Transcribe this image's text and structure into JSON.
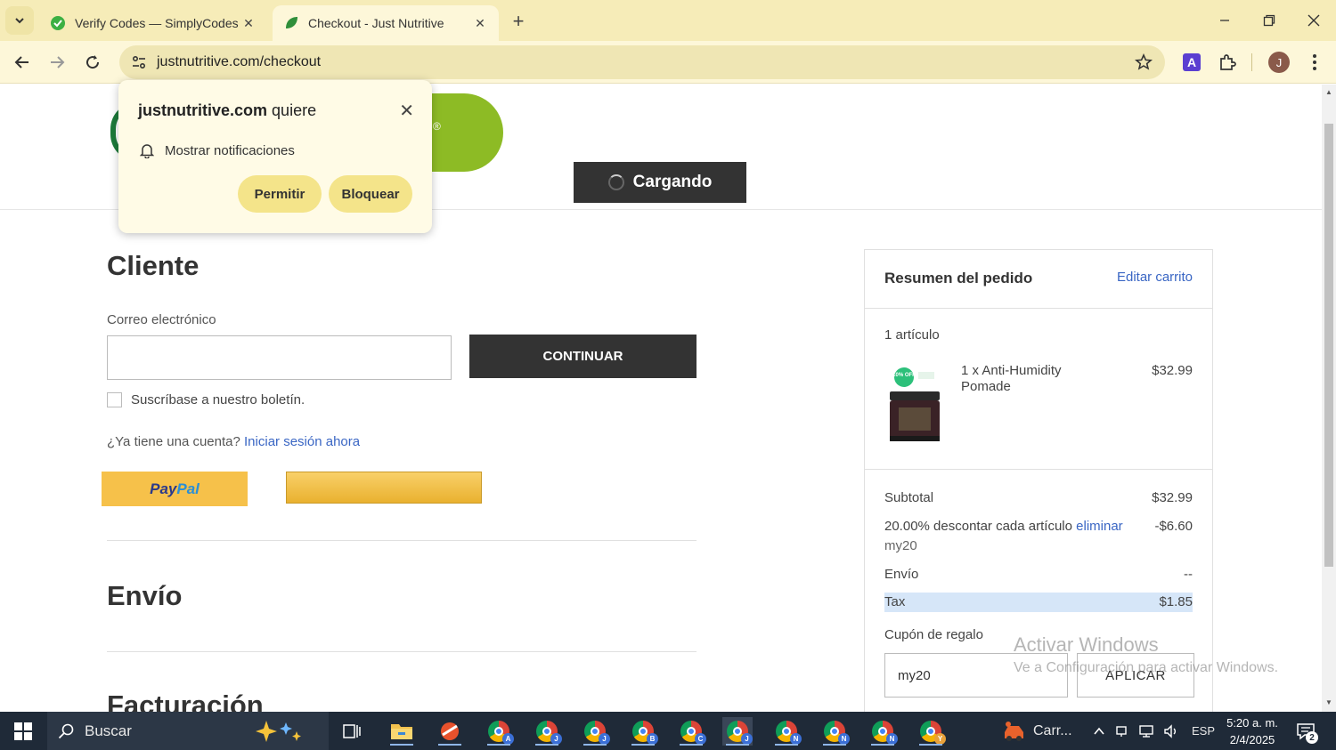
{
  "browser": {
    "tabs": [
      {
        "title": "Verify Codes — SimplyCodes",
        "active": false,
        "icon": "simplycodes-favicon"
      },
      {
        "title": "Checkout - Just Nutritive",
        "active": true,
        "icon": "leaf-favicon"
      }
    ],
    "url": "justnutritive.com/checkout",
    "profile_initial": "J",
    "extension_initial": "A"
  },
  "permission_popup": {
    "site": "justnutritive.com",
    "wants": "quiere",
    "request": "Mostrar notificaciones",
    "allow": "Permitir",
    "block": "Bloquear"
  },
  "header": {
    "loading_label": "Cargando",
    "logo_mark": "®"
  },
  "customer": {
    "heading": "Cliente",
    "email_label": "Correo electrónico",
    "email_value": "",
    "continue_label": "CONTINUAR",
    "newsletter_label": "Suscríbase a nuestro boletín.",
    "account_question": "¿Ya tiene una cuenta?",
    "login_link": "Iniciar sesión ahora",
    "paypal_pay": "Pay",
    "paypal_pal": "Pal"
  },
  "shipping": {
    "heading": "Envío"
  },
  "billing": {
    "heading": "Facturación"
  },
  "summary": {
    "title": "Resumen del pedido",
    "edit_cart": "Editar carrito",
    "item_count": "1 artículo",
    "product_name": "1 x Anti-Humidity Pomade",
    "product_price": "$32.99",
    "product_badge": "10% OFF",
    "subtotal_label": "Subtotal",
    "subtotal_value": "$32.99",
    "discount_label": "20.00% descontar cada artículo",
    "discount_remove": "eliminar",
    "discount_value": "-$6.60",
    "discount_code": "my20",
    "shipping_label": "Envío",
    "shipping_value": "--",
    "tax_label": "Tax",
    "tax_value": "$1.85",
    "coupon_label": "Cupón de regalo",
    "coupon_value": "my20",
    "apply_label": "APLICAR"
  },
  "watermark": {
    "title": "Activar Windows",
    "subtitle": "Ve a Configuración para activar Windows."
  },
  "taskbar": {
    "search_placeholder": "Buscar",
    "apps": [
      {
        "name": "task-view"
      },
      {
        "name": "file-explorer"
      },
      {
        "name": "app-orange"
      },
      {
        "name": "chrome",
        "badge": "A"
      },
      {
        "name": "chrome",
        "badge": "J"
      },
      {
        "name": "chrome",
        "badge": "J"
      },
      {
        "name": "chrome",
        "badge": "B"
      },
      {
        "name": "chrome",
        "badge": "C"
      },
      {
        "name": "chrome",
        "badge": "J"
      },
      {
        "name": "chrome",
        "badge": "N"
      },
      {
        "name": "chrome",
        "badge": "N"
      },
      {
        "name": "chrome",
        "badge": "N"
      },
      {
        "name": "chrome",
        "badge": "Y"
      }
    ],
    "weather_label": "Carr...",
    "language": "ESP",
    "time": "5:20 a. m.",
    "date": "2/4/2025",
    "notification_count": "2"
  }
}
